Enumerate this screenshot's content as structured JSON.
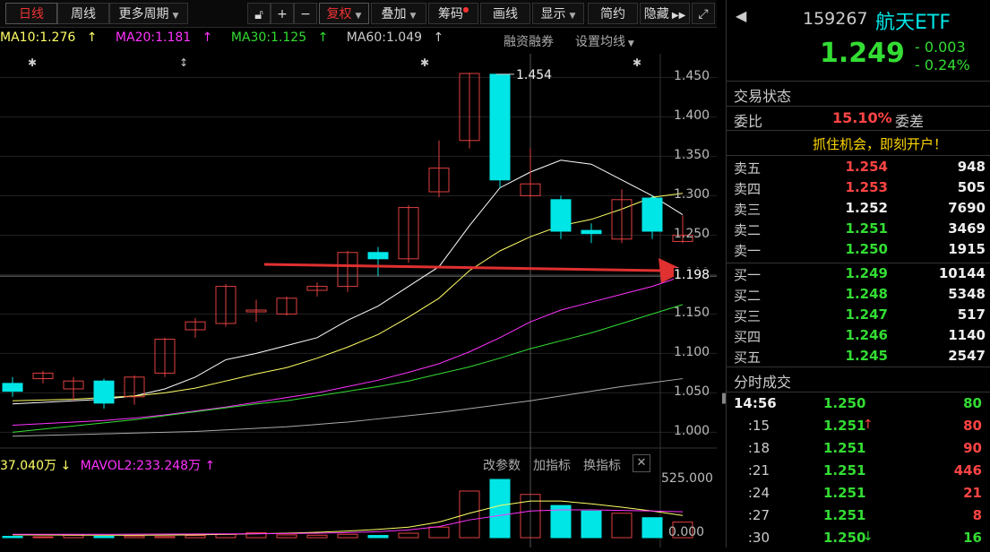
{
  "toolbar": {
    "tabs": [
      "日线",
      "周线",
      "更多周期"
    ],
    "buttons": [
      "复权",
      "叠加",
      "筹码",
      "画线",
      "显示",
      "简约",
      "隐藏"
    ]
  },
  "ma": {
    "ma10": "MA10:1.276",
    "ma20": "MA20:1.181",
    "ma30": "MA30:1.125",
    "ma60": "MA60:1.049",
    "arrow": "↑",
    "links": [
      "融资融券",
      "设置均线"
    ]
  },
  "price_axis": {
    "labels": [
      "1.450",
      "1.400",
      "1.350",
      "1.300",
      "1.250",
      "1.200",
      "1.150",
      "1.100",
      "1.050",
      "1.000"
    ],
    "current": "1.198",
    "high_marker": "1.454"
  },
  "volume": {
    "mavol1": "37.040万",
    "mavol1_arrow": "↓",
    "mavol2": "MAVOL2:233.248万",
    "mavol2_arrow": "↑",
    "links": [
      "改参数",
      "加指标",
      "换指标"
    ],
    "axis_top": "525.000",
    "axis_bottom": "0.000"
  },
  "quote": {
    "code": "159267",
    "name": "航天ETF",
    "price": "1.249",
    "change": "- 0.003",
    "change_pct": "- 0.24%",
    "status_label": "交易状态",
    "weibi_label": "委比",
    "weibi_value": "15.10%",
    "weicha_label": "委差",
    "promo": "抓住机会，即刻开户！",
    "sell": [
      {
        "label": "卖五",
        "price": "1.254",
        "vol": "948",
        "cls": "red"
      },
      {
        "label": "卖四",
        "price": "1.253",
        "vol": "505",
        "cls": "red"
      },
      {
        "label": "卖三",
        "price": "1.252",
        "vol": "7690",
        "cls": "white"
      },
      {
        "label": "卖二",
        "price": "1.251",
        "vol": "3469",
        "cls": "green"
      },
      {
        "label": "卖一",
        "price": "1.250",
        "vol": "1915",
        "cls": "green"
      }
    ],
    "buy": [
      {
        "label": "买一",
        "price": "1.249",
        "vol": "10144",
        "cls": "green"
      },
      {
        "label": "买二",
        "price": "1.248",
        "vol": "5348",
        "cls": "green"
      },
      {
        "label": "买三",
        "price": "1.247",
        "vol": "517",
        "cls": "green"
      },
      {
        "label": "买四",
        "price": "1.246",
        "vol": "1140",
        "cls": "green"
      },
      {
        "label": "买五",
        "price": "1.245",
        "vol": "2547",
        "cls": "green"
      }
    ]
  },
  "ticks": {
    "title": "分时成交",
    "rows": [
      {
        "time": "14:56",
        "price": "1.250",
        "arrow": "",
        "vol": "80",
        "vcls": "green"
      },
      {
        "time": ":15",
        "price": "1.251",
        "arrow": "↑",
        "vol": "80",
        "vcls": "red"
      },
      {
        "time": ":18",
        "price": "1.251",
        "arrow": "",
        "vol": "90",
        "vcls": "red"
      },
      {
        "time": ":21",
        "price": "1.251",
        "arrow": "",
        "vol": "446",
        "vcls": "red"
      },
      {
        "time": ":24",
        "price": "1.251",
        "arrow": "",
        "vol": "21",
        "vcls": "red"
      },
      {
        "time": ":27",
        "price": "1.251",
        "arrow": "",
        "vol": "8",
        "vcls": "red"
      },
      {
        "time": ":30",
        "price": "1.250",
        "arrow": "↓",
        "vol": "16",
        "vcls": "green"
      }
    ]
  },
  "colors": {
    "up": "#e04040",
    "down": "#00e5e5",
    "ma10": "#ffffff",
    "ma20": "#ffff66",
    "ma30": "#ff33ff",
    "ma60": "#33dd33",
    "ma_extra": "#aaaaaa"
  },
  "chart_data": {
    "type": "candlestick",
    "price_range": [
      0.98,
      1.48
    ],
    "candles": [
      {
        "o": 1.062,
        "c": 1.052,
        "h": 1.07,
        "l": 1.045
      },
      {
        "o": 1.068,
        "c": 1.075,
        "h": 1.078,
        "l": 1.062
      },
      {
        "o": 1.055,
        "c": 1.065,
        "h": 1.07,
        "l": 1.04
      },
      {
        "o": 1.065,
        "c": 1.037,
        "h": 1.068,
        "l": 1.03
      },
      {
        "o": 1.045,
        "c": 1.07,
        "h": 1.072,
        "l": 1.035
      },
      {
        "o": 1.075,
        "c": 1.118,
        "h": 1.12,
        "l": 1.07
      },
      {
        "o": 1.13,
        "c": 1.14,
        "h": 1.145,
        "l": 1.12
      },
      {
        "o": 1.138,
        "c": 1.185,
        "h": 1.188,
        "l": 1.134
      },
      {
        "o": 1.155,
        "c": 1.155,
        "h": 1.168,
        "l": 1.14
      },
      {
        "o": 1.15,
        "c": 1.17,
        "h": 1.172,
        "l": 1.148
      },
      {
        "o": 1.18,
        "c": 1.185,
        "h": 1.19,
        "l": 1.172
      },
      {
        "o": 1.185,
        "c": 1.228,
        "h": 1.23,
        "l": 1.178
      },
      {
        "o": 1.228,
        "c": 1.22,
        "h": 1.235,
        "l": 1.198
      },
      {
        "o": 1.22,
        "c": 1.285,
        "h": 1.288,
        "l": 1.215
      },
      {
        "o": 1.305,
        "c": 1.335,
        "h": 1.37,
        "l": 1.298
      },
      {
        "o": 1.37,
        "c": 1.455,
        "h": 1.456,
        "l": 1.36
      },
      {
        "o": 1.454,
        "c": 1.32,
        "h": 1.454,
        "l": 1.31
      },
      {
        "o": 1.3,
        "c": 1.315,
        "h": 1.36,
        "l": 1.298
      },
      {
        "o": 1.295,
        "c": 1.255,
        "h": 1.3,
        "l": 1.245
      },
      {
        "o": 1.256,
        "c": 1.252,
        "h": 1.265,
        "l": 1.24
      },
      {
        "o": 1.245,
        "c": 1.295,
        "h": 1.308,
        "l": 1.24
      },
      {
        "o": 1.297,
        "c": 1.255,
        "h": 1.3,
        "l": 1.245
      },
      {
        "o": 1.242,
        "c": 1.25,
        "h": 1.275,
        "l": 1.24
      }
    ],
    "ma_lines": [
      {
        "name": "MA10",
        "values": [
          1.036,
          1.038,
          1.04,
          1.042,
          1.046,
          1.055,
          1.07,
          1.092,
          1.1,
          1.11,
          1.12,
          1.142,
          1.16,
          1.185,
          1.21,
          1.262,
          1.31,
          1.33,
          1.345,
          1.34,
          1.32,
          1.3,
          1.276
        ]
      },
      {
        "name": "MA20",
        "values": [
          1.04,
          1.041,
          1.042,
          1.044,
          1.046,
          1.05,
          1.056,
          1.065,
          1.074,
          1.082,
          1.094,
          1.108,
          1.124,
          1.146,
          1.17,
          1.205,
          1.23,
          1.248,
          1.262,
          1.27,
          1.283,
          1.298,
          1.303
        ]
      },
      {
        "name": "MA30",
        "values": [
          1.009,
          1.011,
          1.013,
          1.015,
          1.018,
          1.022,
          1.027,
          1.032,
          1.038,
          1.044,
          1.05,
          1.058,
          1.066,
          1.076,
          1.087,
          1.102,
          1.12,
          1.14,
          1.155,
          1.165,
          1.175,
          1.185,
          1.198
        ]
      },
      {
        "name": "MA60",
        "values": [
          1.0,
          1.004,
          1.008,
          1.012,
          1.016,
          1.021,
          1.026,
          1.031,
          1.036,
          1.04,
          1.046,
          1.052,
          1.058,
          1.065,
          1.074,
          1.083,
          1.094,
          1.106,
          1.116,
          1.126,
          1.138,
          1.15,
          1.162
        ]
      },
      {
        "name": "MA_extra",
        "values": [
          0.995,
          0.996,
          0.997,
          0.998,
          0.999,
          1.0,
          1.001,
          1.003,
          1.005,
          1.007,
          1.01,
          1.013,
          1.017,
          1.021,
          1.025,
          1.03,
          1.035,
          1.04,
          1.046,
          1.052,
          1.058,
          1.063,
          1.068
        ]
      }
    ],
    "volumes": [
      12,
      8,
      22,
      12,
      15,
      10,
      20,
      30,
      45,
      25,
      22,
      30,
      20,
      40,
      95,
      420,
      525,
      390,
      290,
      240,
      220,
      180,
      140
    ],
    "volume_max": 525,
    "mavol_line": [
      25,
      24,
      23,
      22,
      22,
      23,
      25,
      30,
      35,
      40,
      48,
      60,
      75,
      95,
      140,
      220,
      290,
      330,
      330,
      305,
      275,
      240,
      200
    ],
    "mavol_line2": [
      30,
      30,
      30,
      30,
      31,
      32,
      33,
      34,
      35,
      37,
      40,
      45,
      55,
      70,
      100,
      160,
      200,
      240,
      250,
      250,
      245,
      240,
      233
    ]
  }
}
